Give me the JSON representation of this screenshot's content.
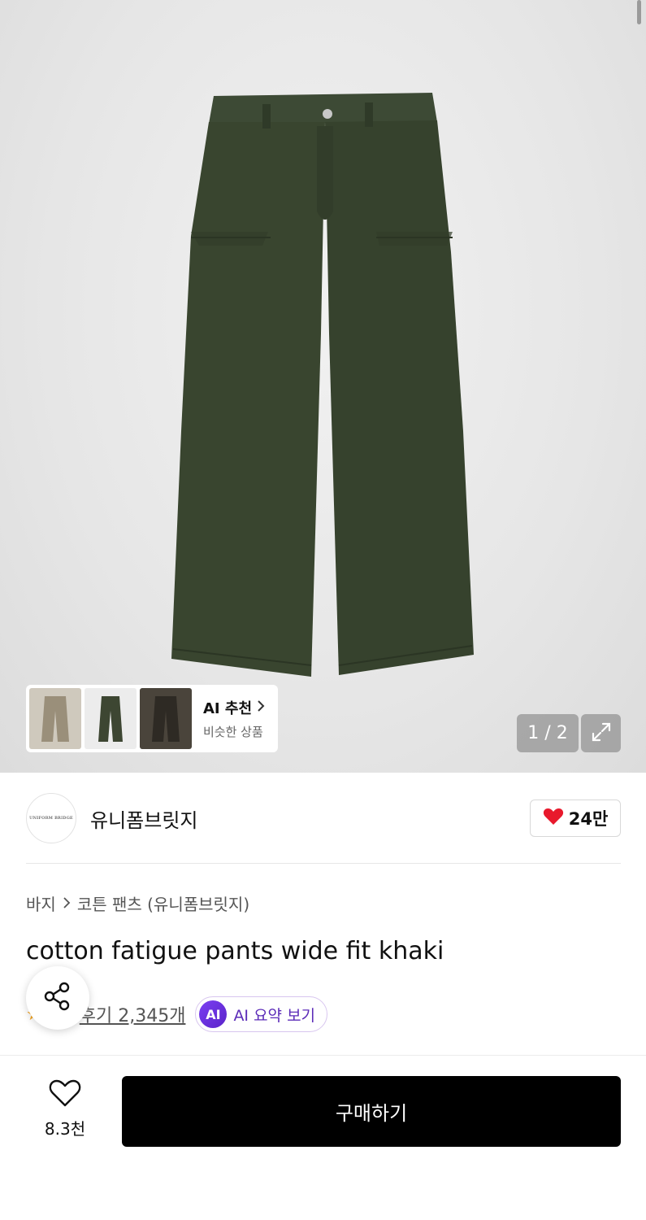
{
  "gallery": {
    "counter": "1 / 2",
    "ai_recommend": {
      "title": "AI 추천",
      "subtitle": "비슷한 상품"
    }
  },
  "brand": {
    "logo_text": "UNIFORM BRIDGE",
    "name": "유니폼브릿지",
    "likes": "24만"
  },
  "breadcrumb": {
    "category": "바지",
    "subcategory": "코튼 팬츠 (유니폼브릿지)"
  },
  "product": {
    "title": "cotton fatigue pants wide fit khaki",
    "reviews_label": "후기 2,345개",
    "ai_badge": "AI",
    "ai_summary_label": "AI 요약 보기"
  },
  "bottom_bar": {
    "wish_count": "8.3천",
    "buy_label": "구매하기"
  },
  "colors": {
    "pants": "#3a4632",
    "buy_button": "#000000",
    "heart": "#e8192c",
    "ai_accent": "#6a32e0"
  }
}
